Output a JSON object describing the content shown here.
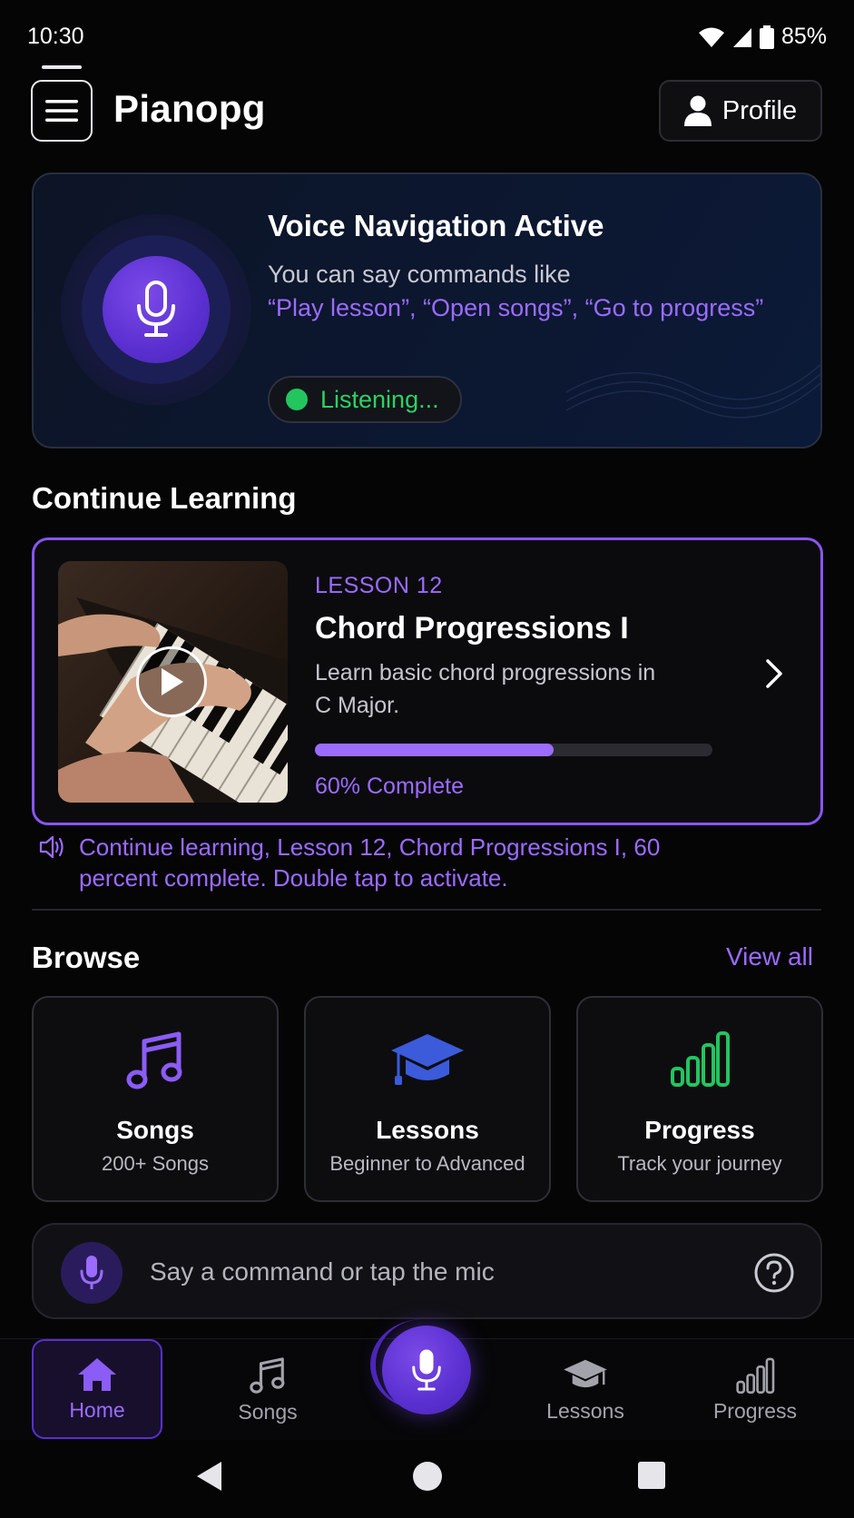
{
  "status_bar": {
    "time": "10:30",
    "battery": "85%"
  },
  "app_bar": {
    "title": "Pianopg",
    "profile_label": "Profile"
  },
  "voice_card": {
    "title": "Voice Navigation Active",
    "description": "You can say commands like",
    "commands": "“Play lesson”, “Open songs”, “Go to progress”",
    "status": "Listening..."
  },
  "continue": {
    "section_title": "Continue Learning",
    "lesson_tag": "LESSON 12",
    "lesson_title": "Chord Progressions I",
    "lesson_description": "Learn basic chord progressions in C Major.",
    "progress_percent": 60,
    "progress_text": "60% Complete",
    "accessibility_announcement": "Continue learning, Lesson 12, Chord Progressions I, 60 percent complete. Double tap to activate."
  },
  "browse": {
    "section_title": "Browse",
    "view_all": "View all",
    "tiles": [
      {
        "title": "Songs",
        "subtitle": "200+ Songs",
        "icon": "music-note-icon",
        "color": "#8b5cf6"
      },
      {
        "title": "Lessons",
        "subtitle": "Beginner to Advanced",
        "icon": "graduation-cap-icon",
        "color": "#3b5bdb"
      },
      {
        "title": "Progress",
        "subtitle": "Track your journey",
        "icon": "bar-chart-icon",
        "color": "#22c55e"
      }
    ]
  },
  "command_bar": {
    "placeholder": "Say a command or tap the mic"
  },
  "bottom_nav": {
    "items": [
      {
        "label": "Home",
        "icon": "home-icon",
        "active": true
      },
      {
        "label": "Songs",
        "icon": "music-note-icon",
        "active": false
      },
      {
        "label": "Lessons",
        "icon": "graduation-cap-icon",
        "active": false
      },
      {
        "label": "Progress",
        "icon": "bar-chart-icon",
        "active": false
      }
    ]
  },
  "colors": {
    "accent": "#9c6bff",
    "listening": "#22c55e",
    "background": "#050506"
  }
}
